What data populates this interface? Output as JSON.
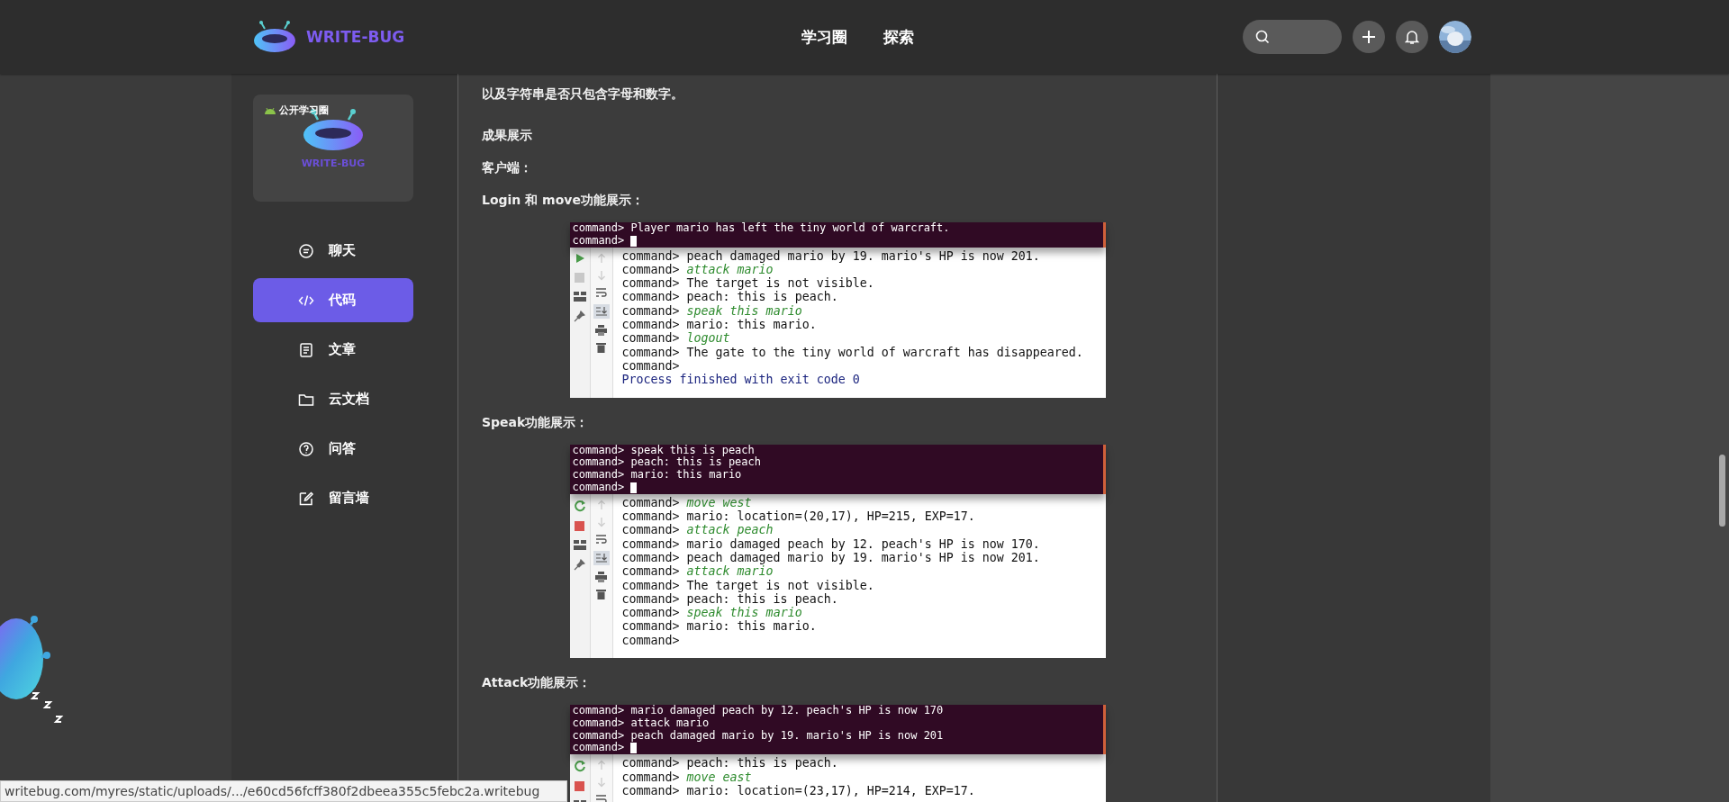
{
  "header": {
    "logo_text": "WRITE-BUG",
    "nav": [
      {
        "label": "学习圈"
      },
      {
        "label": "探索"
      }
    ]
  },
  "sidebar": {
    "card": {
      "badge": "公开学习圈",
      "logo_text": "WRITE-BUG"
    },
    "items": [
      {
        "label": "聊天",
        "kind": "chat",
        "selected": false
      },
      {
        "label": "代码",
        "kind": "code",
        "selected": true
      },
      {
        "label": "文章",
        "kind": "article",
        "selected": false
      },
      {
        "label": "云文档",
        "kind": "folder",
        "selected": false
      },
      {
        "label": "问答",
        "kind": "question",
        "selected": false
      },
      {
        "label": "留言墙",
        "kind": "edit",
        "selected": false
      }
    ]
  },
  "article": {
    "blocks": [
      {
        "kind": "paragraph",
        "lines": [
          "以及字符串是否只包含字母和数字。"
        ]
      },
      {
        "kind": "label",
        "text": "成果展示"
      },
      {
        "kind": "label",
        "text": "客户端："
      },
      {
        "kind": "label",
        "text": "Login 和 move功能展示："
      },
      {
        "kind": "terminal",
        "running": false,
        "top_lines": [
          "command> Player mario has left the tiny world of warcraft.",
          "command>"
        ],
        "console_lines": [
          {
            "kind": "output",
            "text": "command> peach damaged mario by 19. mario's HP is now 201."
          },
          {
            "kind": "output",
            "text": "command> *attack mario*"
          },
          {
            "kind": "output",
            "text": "command> The target is not visible."
          },
          {
            "kind": "output",
            "text": "command> peach: this is peach."
          },
          {
            "kind": "output",
            "text": "command> *speak this mario*"
          },
          {
            "kind": "output",
            "text": "command> mario: this mario."
          },
          {
            "kind": "output",
            "text": "command> *logout*"
          },
          {
            "kind": "output",
            "text": "command> The gate to the tiny world of warcraft has disappeared."
          },
          {
            "kind": "output",
            "text": "command>"
          },
          {
            "kind": "exit",
            "text": "Process finished with exit code 0"
          }
        ]
      },
      {
        "kind": "label",
        "text": "Speak功能展示："
      },
      {
        "kind": "terminal",
        "running": true,
        "top_lines": [
          "command> speak this is peach",
          "command> peach: this is peach",
          "command> mario: this mario",
          "command>"
        ],
        "console_lines": [
          {
            "kind": "output",
            "text": "command> *move west*"
          },
          {
            "kind": "output",
            "text": "command> mario: location=(20,17), HP=215, EXP=17."
          },
          {
            "kind": "output",
            "text": "command> *attack peach*"
          },
          {
            "kind": "output",
            "text": "command> mario damaged peach by 12. peach's HP is now 170."
          },
          {
            "kind": "output",
            "text": "command> peach damaged mario by 19. mario's HP is now 201."
          },
          {
            "kind": "output",
            "text": "command> *attack mario*"
          },
          {
            "kind": "output",
            "text": "command> The target is not visible."
          },
          {
            "kind": "output",
            "text": "command> peach: this is peach."
          },
          {
            "kind": "output",
            "text": "command> *speak this mario*"
          },
          {
            "kind": "output",
            "text": "command> mario: this mario."
          },
          {
            "kind": "output",
            "text": "command>"
          }
        ]
      },
      {
        "kind": "label",
        "text": "Attack功能展示："
      },
      {
        "kind": "terminal",
        "running": true,
        "top_lines": [
          "command> mario damaged peach by 12. peach's HP is now 170",
          "command> attack mario",
          "command> peach damaged mario by 19. mario's HP is now 201",
          "command>"
        ],
        "console_lines": [
          {
            "kind": "output",
            "text": "command> peach: this is peach."
          },
          {
            "kind": "output",
            "text": "command> *move east*"
          },
          {
            "kind": "output",
            "text": "command> mario: location=(23,17), HP=214, EXP=17."
          }
        ]
      }
    ]
  },
  "status_bar": {
    "url": "writebug.com/myres/static/uploads/.../e60cd56fcff380f2dbeea355c5febc2a.writebug"
  }
}
